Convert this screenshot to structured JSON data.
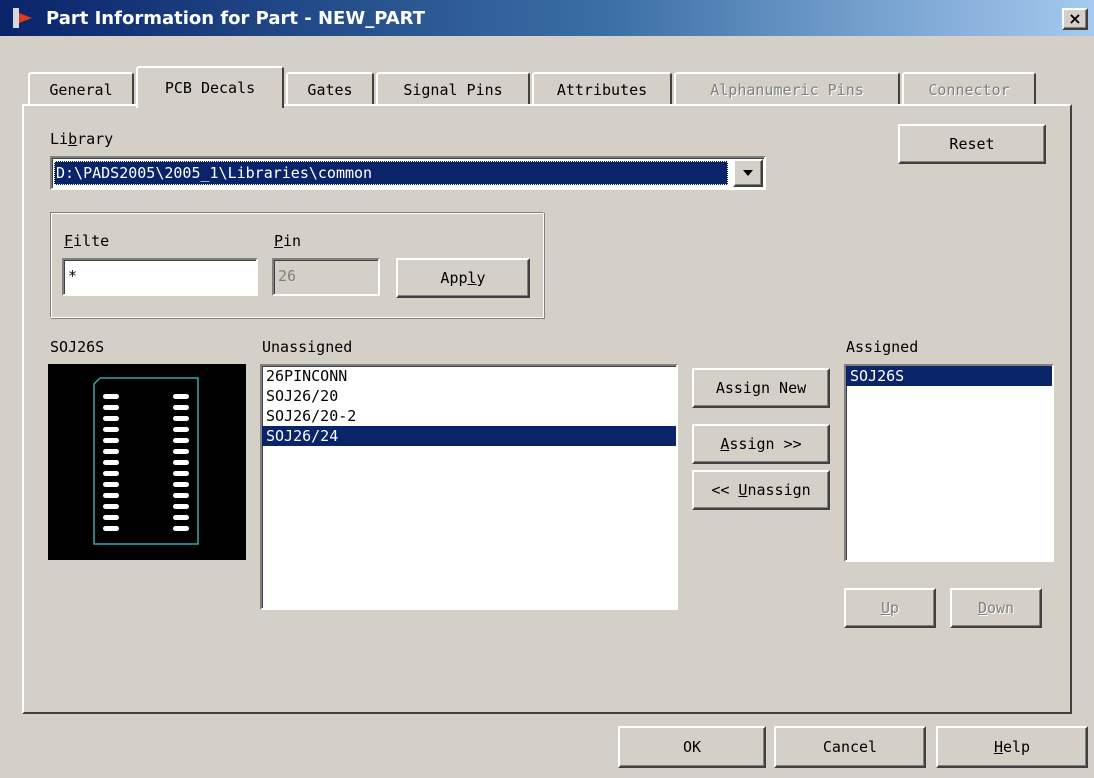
{
  "window": {
    "title": "Part Information for Part - NEW_PART",
    "close_label": "×"
  },
  "tabs": [
    {
      "label": "General",
      "state": "normal"
    },
    {
      "label": "PCB Decals",
      "state": "active"
    },
    {
      "label": "Gates",
      "state": "normal"
    },
    {
      "label": "Signal Pins",
      "state": "normal"
    },
    {
      "label": "Attributes",
      "state": "normal"
    },
    {
      "label": "Alphanumeric Pins",
      "state": "disabled"
    },
    {
      "label": "Connector",
      "state": "disabled"
    }
  ],
  "library": {
    "label": "Library",
    "value": "D:\\PADS2005\\2005_1\\Libraries\\common"
  },
  "reset_label": "Reset",
  "filter": {
    "filter_label": "Filte",
    "filter_value": "*",
    "pin_label": "Pin",
    "pin_value": "26",
    "apply_label": "Apply"
  },
  "preview": {
    "label": "SOJ26S",
    "pads_per_column": 13
  },
  "unassigned": {
    "label": "Unassigned",
    "items": [
      "26PINCONN",
      "SOJ26/20",
      "SOJ26/20-2",
      "SOJ26/24"
    ],
    "selected_index": 3
  },
  "actions": {
    "assign_new": "Assign New",
    "assign": "Assign >>",
    "unassign": "<< Unassign"
  },
  "assigned": {
    "label": "Assigned",
    "items": [
      "SOJ26S"
    ],
    "selected_index": 0
  },
  "order": {
    "up": "Up",
    "down": "Down"
  },
  "footer": {
    "ok": "OK",
    "cancel": "Cancel",
    "help": "Help"
  },
  "colors": {
    "face": "#d4d0c8",
    "selection": "#0a246a",
    "title_start": "#0a246a",
    "title_end": "#a6caf0",
    "decal_outline": "#3aa6a6",
    "decal_pad": "#ffffff"
  }
}
